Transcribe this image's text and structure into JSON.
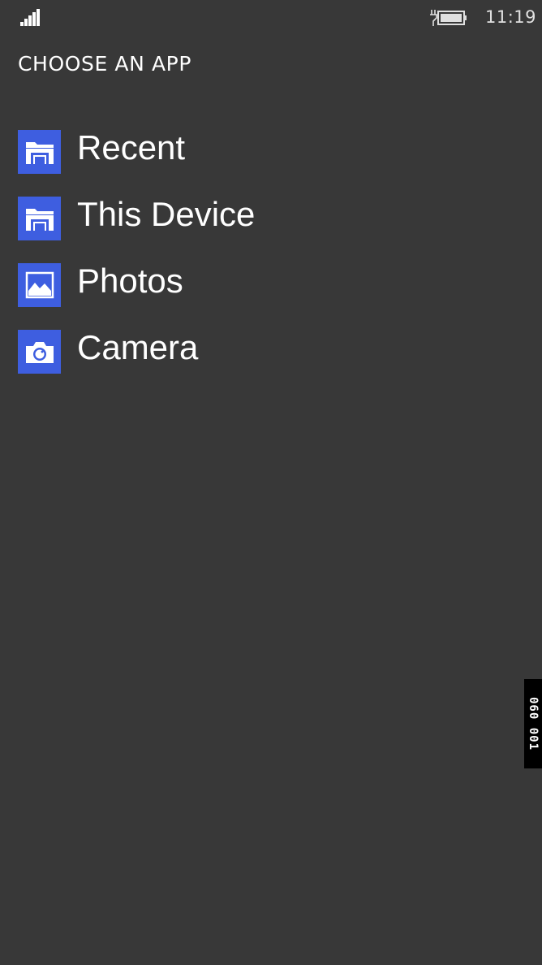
{
  "status_bar": {
    "time": "11:19",
    "signal_icon": "signal-strength-icon",
    "battery_icon": "battery-charging-icon"
  },
  "page": {
    "title": "CHOOSE AN APP"
  },
  "apps": [
    {
      "label": "Recent",
      "icon": "folder-icon"
    },
    {
      "label": "This Device",
      "icon": "folder-icon"
    },
    {
      "label": "Photos",
      "icon": "photos-icon"
    },
    {
      "label": "Camera",
      "icon": "camera-icon"
    }
  ],
  "side_tab": {
    "text": "060   001"
  },
  "colors": {
    "background": "#383838",
    "accent": "#3e5ee0",
    "text": "#ffffff"
  }
}
